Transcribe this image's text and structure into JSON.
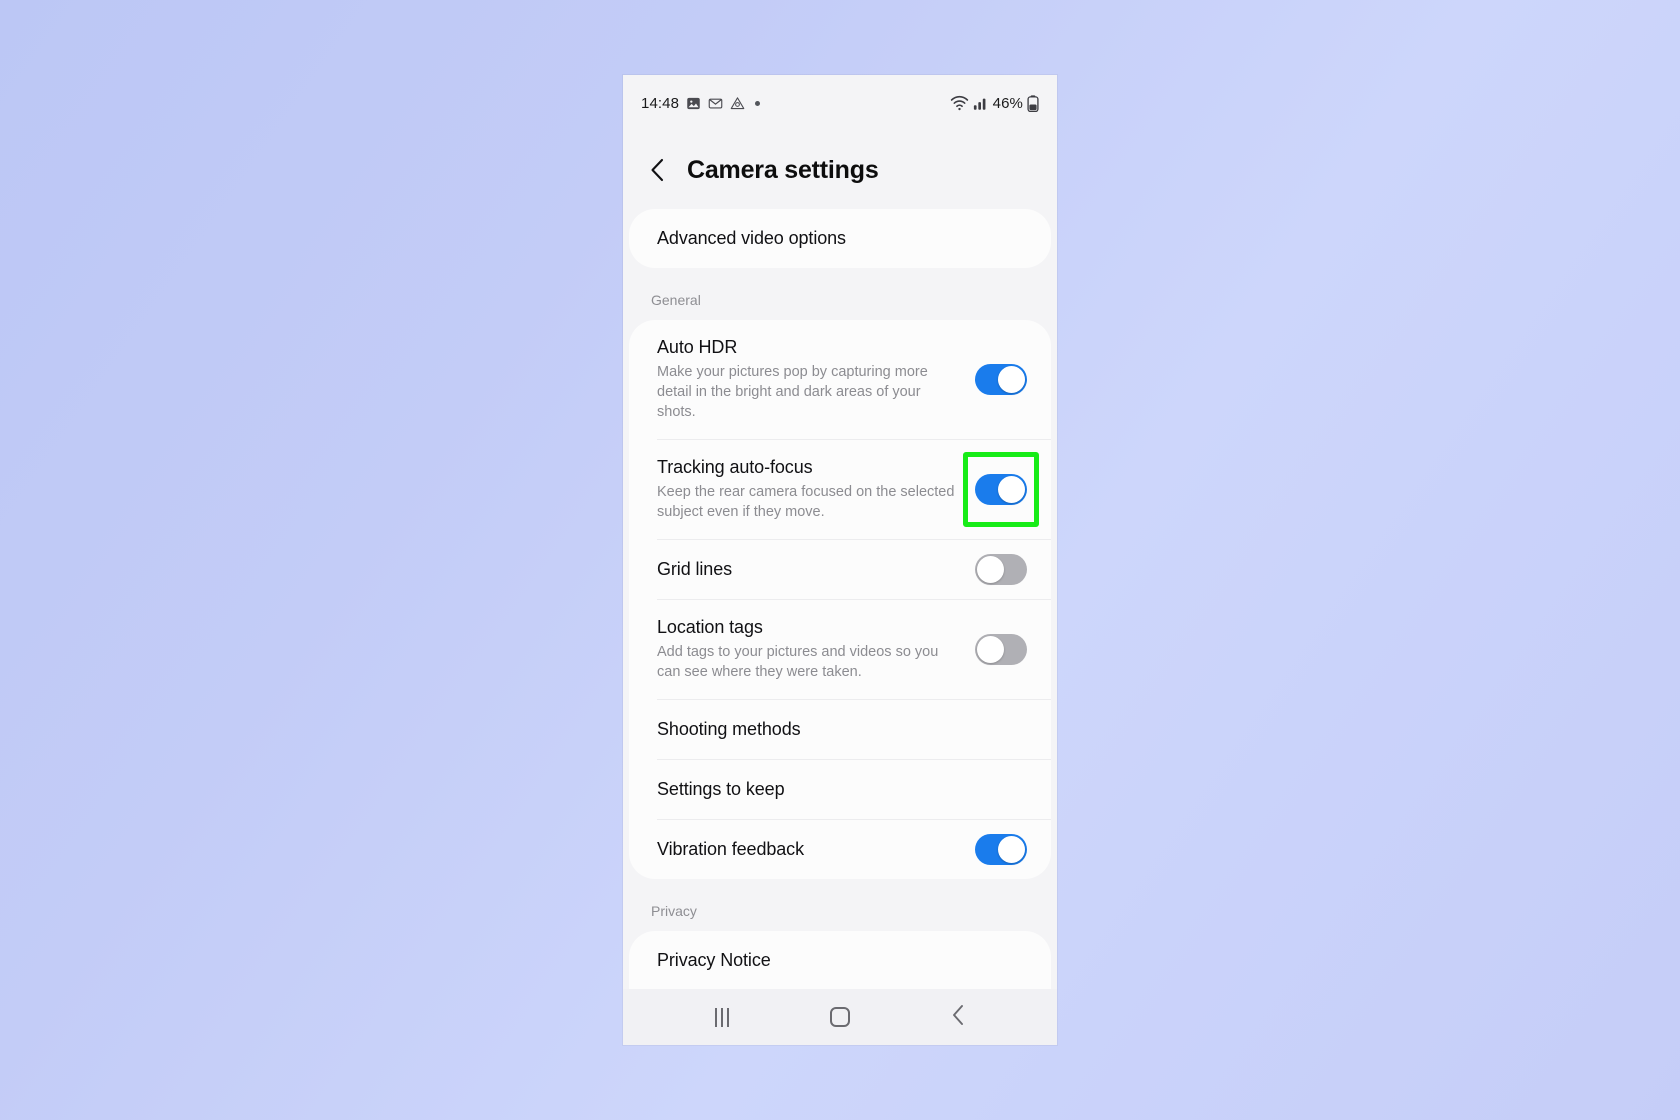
{
  "statusbar": {
    "time": "14:48",
    "left_icons": [
      "image-icon",
      "gmail-icon",
      "drive-icon",
      "dot-icon"
    ],
    "right_icons": [
      "wifi-icon",
      "signal-icon",
      "battery-icon"
    ],
    "battery_percent": "46%"
  },
  "header": {
    "title": "Camera settings",
    "back_icon": "back-chevron-icon"
  },
  "top_item": {
    "label": "Advanced video options"
  },
  "sections": [
    {
      "label": "General",
      "items": [
        {
          "title": "Auto HDR",
          "desc": "Make your pictures pop by capturing more detail in the bright and dark areas of your shots.",
          "control": "toggle",
          "state": "on"
        },
        {
          "title": "Tracking auto-focus",
          "desc": "Keep the rear camera focused on the selected subject even if they move.",
          "control": "toggle",
          "state": "on",
          "highlighted": true
        },
        {
          "title": "Grid lines",
          "desc": "",
          "control": "toggle",
          "state": "off"
        },
        {
          "title": "Location tags",
          "desc": "Add tags to your pictures and videos so you can see where they were taken.",
          "control": "toggle",
          "state": "off"
        },
        {
          "title": "Shooting methods",
          "desc": "",
          "control": "none"
        },
        {
          "title": "Settings to keep",
          "desc": "",
          "control": "none"
        },
        {
          "title": "Vibration feedback",
          "desc": "",
          "control": "toggle",
          "state": "on"
        }
      ]
    },
    {
      "label": "Privacy",
      "items": [
        {
          "title": "Privacy Notice",
          "desc": "",
          "control": "none"
        }
      ]
    }
  ],
  "navbar": {
    "recents_label": "recents-button",
    "home_label": "home-button",
    "back_label": "back-button"
  },
  "colors": {
    "toggle_on": "#1a7cec",
    "toggle_off": "#b0b0b5",
    "highlight": "#17ec17",
    "card_bg": "#fcfcfc",
    "page_bg": "#f4f4f6"
  }
}
